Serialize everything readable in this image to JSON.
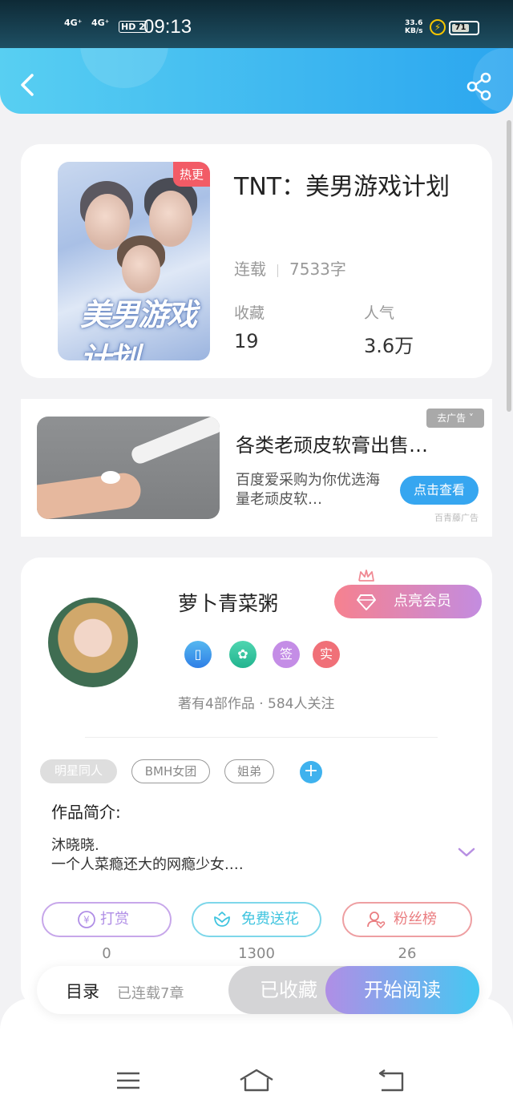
{
  "status_bar": {
    "signal_1": "4G⁺",
    "signal_2": "4G⁺",
    "hd": "HD 2",
    "time": "09:13",
    "net_speed": "33.6",
    "net_unit": "KB/s",
    "battery": "71",
    "battery_level": 0.71
  },
  "book": {
    "title": "TNT：美男游戏计划",
    "hot_tag": "热更",
    "cover_title": "美男游戏计划",
    "status": "连载",
    "word_count": "7533字",
    "collect_label": "收藏",
    "collect_value": "19",
    "popularity_label": "人气",
    "popularity_value": "3.6万"
  },
  "ad": {
    "title": "各类老顽皮软膏出售…",
    "desc": "百度爱采购为你优选海量老顽皮软…",
    "button": "点击查看",
    "close": "去广告",
    "source": "百青藤广告"
  },
  "author": {
    "name": "萝卜青菜粥",
    "vip_button": "点亮会员",
    "badge_sign": "签",
    "badge_real": "实",
    "stats": "著有4部作品 · 584人关注",
    "tags": [
      "明星同人",
      "BMH女团",
      "姐弟"
    ],
    "tag_plus": "+",
    "intro_label": "作品简介:",
    "intro_line_1": "沐晓晓.",
    "intro_line_2": "一个人菜瘾还大的网瘾少女.…",
    "actions": [
      {
        "label": "打赏",
        "count": "0"
      },
      {
        "label": "免费送花",
        "count": "1300"
      },
      {
        "label": "粉丝榜",
        "count": "26"
      }
    ]
  },
  "bottom_bar": {
    "toc": "目录",
    "toc_sub": "已连载7章",
    "collected": "已收藏",
    "read": "开始阅读"
  },
  "colors": {
    "accent": "#2ba6ef",
    "hot": "#f25b66",
    "tip": "#b08ee6",
    "flower": "#3fc4df",
    "fans": "#ea7d80"
  }
}
